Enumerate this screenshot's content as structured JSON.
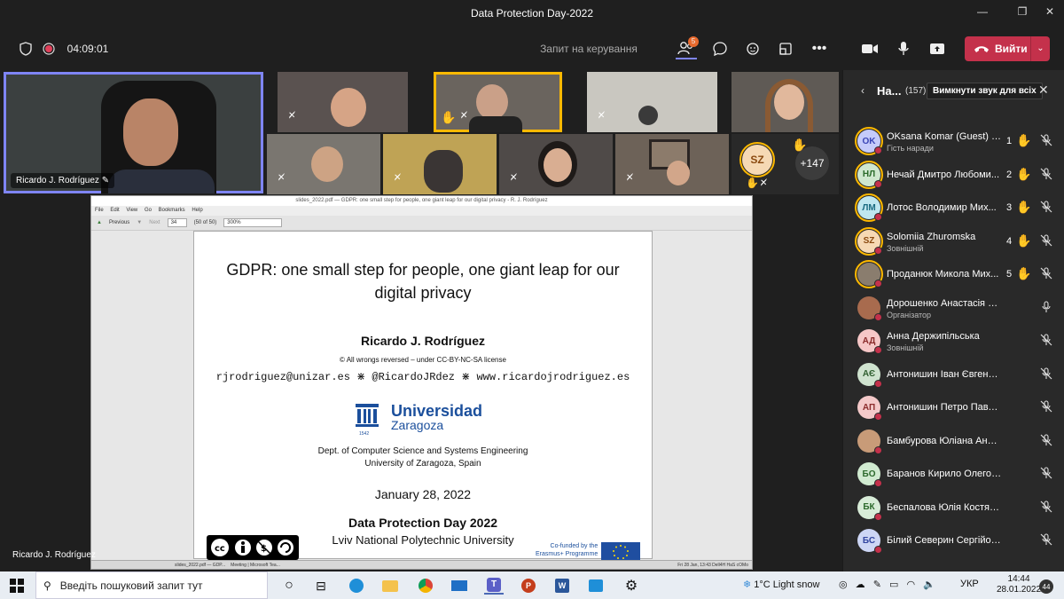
{
  "window": {
    "title": "Data Protection Day-2022"
  },
  "toolbar": {
    "timer": "04:09:01",
    "request_control": "Запит на керування",
    "participants_badge": "5",
    "leave_label": "Вийти"
  },
  "tiles": {
    "main_name": "Ricardo J. Rodríguez",
    "overflow_count": "+147",
    "sz_initials": "SZ",
    "share_owner": "Ricardo J. Rodríguez"
  },
  "shared_window": {
    "title": "slides_2022.pdf — GDPR: one small step for people, one giant leap for our digital privacy - R. J. Rodríguez",
    "menu": [
      "File",
      "Edit",
      "View",
      "Go",
      "Bookmarks",
      "Help"
    ],
    "nav_prev": "Previous",
    "nav_next": "Next",
    "page_value": "34",
    "page_total": "(50 of 50)",
    "zoom": "300%",
    "taskbar_left_1": "slides_2022.pdf — GDP...",
    "taskbar_left_2": "Meeting | Microsoft Tea...",
    "taskbar_right": "Fri 28 Jan, 13:43   Dell4H HaS cOMo"
  },
  "slide": {
    "title": "GDPR: one small step for people, one giant leap for our digital privacy",
    "author": "Ricardo J. Rodríguez",
    "rights": "© All wrongs reversed – under CC-BY-NC-SA license",
    "contact": "rjrodriguez@unizar.es ⋇ @RicardoJRdez ⋇ www.ricardojrodriguez.es",
    "logo_line1": "Universidad",
    "logo_line2": "Zaragoza",
    "logo_year": "1542",
    "dept": "Dept. of Computer Science and Systems Engineering",
    "univ": "University of Zaragoza, Spain",
    "date": "January 28, 2022",
    "event": "Data Protection Day 2022",
    "place": "Lviv National Polytechnic University",
    "cofund": "Co-funded by the\nErasmus+ Programme"
  },
  "panel": {
    "title": "На...",
    "count": "(157)",
    "mute_all": "Вимкнути звук для всіх",
    "participants": [
      {
        "initials": "OK",
        "name": "OKsana Komar (Guest) (г...",
        "role": "Гість наради",
        "order": "1",
        "hand": true,
        "bg": "#c5cbfa",
        "fg": "#3a45b5",
        "ring": true
      },
      {
        "initials": "НЛ",
        "name": "Нечай Дмитро Любоми...",
        "role": "",
        "order": "2",
        "hand": true,
        "bg": "#cfe8cf",
        "fg": "#2b6b2b",
        "ring": true
      },
      {
        "initials": "ЛМ",
        "name": "Лотос Володимир Мих...",
        "role": "",
        "order": "3",
        "hand": true,
        "bg": "#bfe6ef",
        "fg": "#1a6a80",
        "ring": true
      },
      {
        "initials": "SZ",
        "name": "Solomiia Zhuromska",
        "role": "Зовнішній",
        "order": "4",
        "hand": true,
        "bg": "#f6d9b4",
        "fg": "#8a4a10",
        "ring": true
      },
      {
        "initials": "",
        "name": "Проданюк Микола Мих...",
        "role": "",
        "order": "5",
        "hand": true,
        "bg": "#8a7d6e",
        "fg": "#fff",
        "ring": true
      },
      {
        "initials": "",
        "name": "Дорошенко Анастасія Володи...",
        "role": "Організатор",
        "order": "",
        "hand": false,
        "bg": "#a86b4e",
        "fg": "#fff",
        "ring": false
      },
      {
        "initials": "АД",
        "name": "Анна Держипільська",
        "role": "Зовнішній",
        "order": "",
        "hand": false,
        "bg": "#f6c7c7",
        "fg": "#8a2a2a",
        "ring": false
      },
      {
        "initials": "АЄ",
        "name": "Антонишин Іван Євгенович",
        "role": "",
        "order": "",
        "hand": false,
        "bg": "#cfe3cf",
        "fg": "#2f5f2f",
        "ring": false
      },
      {
        "initials": "АП",
        "name": "Антонишин Петро Павлович",
        "role": "",
        "order": "",
        "hand": false,
        "bg": "#f4c9c9",
        "fg": "#8c2c2c",
        "ring": false
      },
      {
        "initials": "",
        "name": "Бамбурова Юліана Андріївна",
        "role": "",
        "order": "",
        "hand": false,
        "bg": "#c89b78",
        "fg": "#fff",
        "ring": false
      },
      {
        "initials": "БО",
        "name": "Баранов Кирило Олегович",
        "role": "",
        "order": "",
        "hand": false,
        "bg": "#d1ebd1",
        "fg": "#2c6a2c",
        "ring": false
      },
      {
        "initials": "БК",
        "name": "Беспалова Юлія Костянтинівна",
        "role": "",
        "order": "",
        "hand": false,
        "bg": "#d8ecd8",
        "fg": "#2d6a2d",
        "ring": false
      },
      {
        "initials": "БС",
        "name": "Білий Северин Сергійович",
        "role": "",
        "order": "",
        "hand": false,
        "bg": "#cdd6f5",
        "fg": "#3346a0",
        "ring": false
      }
    ]
  },
  "taskbar": {
    "search_placeholder": "Введіть пошуковий запит тут",
    "weather": "1°C  Light snow",
    "lang": "УКР",
    "time": "14:44",
    "date": "28.01.2022",
    "notifications": "44"
  }
}
